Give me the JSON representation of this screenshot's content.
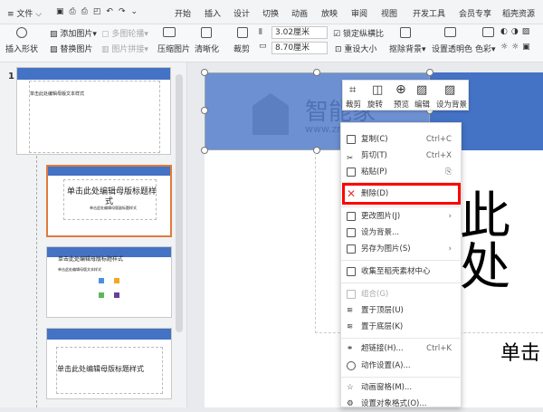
{
  "menubar": {
    "file": "文件",
    "tabs": [
      "开始",
      "插入",
      "设计",
      "切换",
      "动画",
      "放映",
      "审阅",
      "视图",
      "开发工具",
      "会员专享",
      "稻壳资源"
    ]
  },
  "ribbon": {
    "insert_shape": "插入形状",
    "add_picture": "添加图片",
    "replace_picture": "替换图片",
    "multi_carousel": "多图轮播",
    "picture_splice": "图片拼接",
    "compress": "压缩图片",
    "clarity": "清晰化",
    "crop": "裁剪",
    "height": "3.02厘米",
    "width": "8.70厘米",
    "lock_ratio": "锁定纵横比",
    "reset_size": "重设大小",
    "remove_bg": "抠除背景",
    "set_transparent": "设置透明色",
    "color": "色彩"
  },
  "slides": {
    "number": "1",
    "master_title": "单击此处编辑母版标题样式",
    "title_wrap1": "单击此处编辑母版标题样",
    "title_wrap2": "式",
    "text_style": "单击此处编辑母版文本样式",
    "subtitle": "单击此处编辑母版副标题样式"
  },
  "canvas": {
    "big_text": "此处",
    "sub_text": "单击",
    "watermark": "智能家",
    "watermark_url": "www.zn...com"
  },
  "mini_toolbar": [
    "裁剪",
    "旋转",
    "预览",
    "编辑",
    "设为背景"
  ],
  "context_menu": {
    "copy": "复制(C)",
    "copy_sc": "Ctrl+C",
    "cut": "剪切(T)",
    "cut_sc": "Ctrl+X",
    "paste": "粘贴(P)",
    "delete": "删除(D)",
    "change_picture": "更改图片(J)",
    "set_background": "设为背景...",
    "save_as_picture": "另存为图片(S)",
    "collect": "收集至稻壳素材中心",
    "group": "组合(G)",
    "bring_front": "置于顶层(U)",
    "send_back": "置于底层(K)",
    "hyperlink": "超链接(H)...",
    "hyperlink_sc": "Ctrl+K",
    "action": "动作设置(A)...",
    "anim_pane": "动画窗格(M)...",
    "format": "设置对象格式(O)..."
  },
  "colors": {
    "accent": "#4472c4",
    "highlight": "#ff0000",
    "selected_thumb": "#e07b39"
  }
}
